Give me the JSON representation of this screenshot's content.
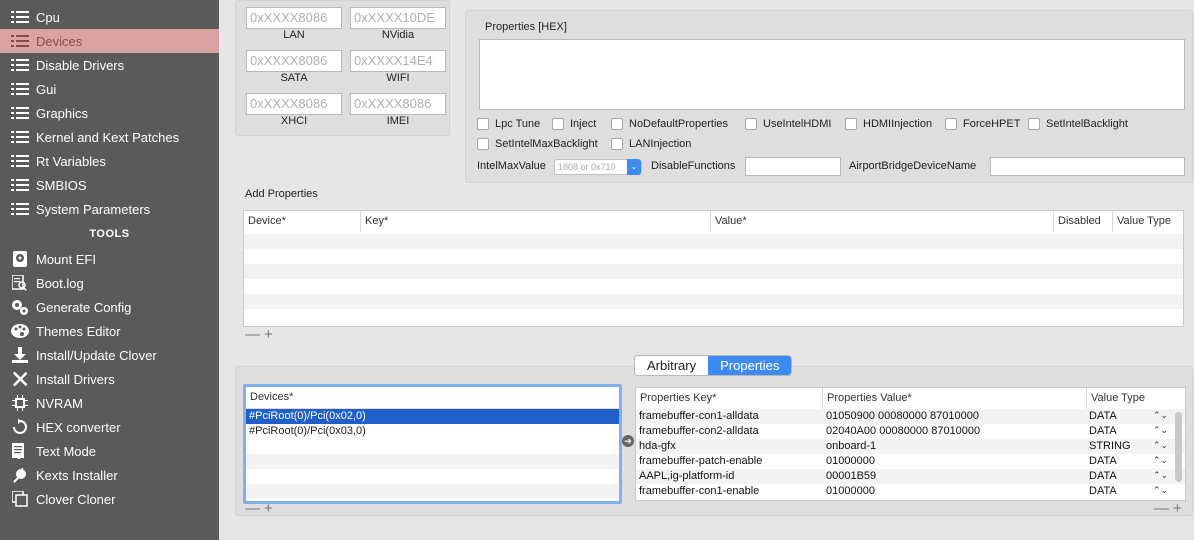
{
  "sidebar": {
    "items": [
      {
        "label": "Cpu",
        "icon": "list-icon",
        "active": false
      },
      {
        "label": "Devices",
        "icon": "list-icon",
        "active": true
      },
      {
        "label": "Disable Drivers",
        "icon": "list-icon",
        "active": false
      },
      {
        "label": "Gui",
        "icon": "list-icon",
        "active": false
      },
      {
        "label": "Graphics",
        "icon": "list-icon",
        "active": false
      },
      {
        "label": "Kernel and Kext Patches",
        "icon": "list-icon",
        "active": false
      },
      {
        "label": "Rt Variables",
        "icon": "list-icon",
        "active": false
      },
      {
        "label": "SMBIOS",
        "icon": "list-icon",
        "active": false
      },
      {
        "label": "System Parameters",
        "icon": "list-icon",
        "active": false
      }
    ],
    "tools_header": "TOOLS",
    "tools": [
      {
        "label": "Mount EFI",
        "icon": "disk-icon"
      },
      {
        "label": "Boot.log",
        "icon": "log-search-icon"
      },
      {
        "label": "Generate Config",
        "icon": "gears-icon"
      },
      {
        "label": "Themes Editor",
        "icon": "palette-icon"
      },
      {
        "label": "Install/Update Clover",
        "icon": "download-icon"
      },
      {
        "label": "Install Drivers",
        "icon": "tools-icon"
      },
      {
        "label": "NVRAM",
        "icon": "chip-icon"
      },
      {
        "label": "HEX converter",
        "icon": "refresh-icon"
      },
      {
        "label": "Text Mode",
        "icon": "text-icon"
      },
      {
        "label": "Kexts Installer",
        "icon": "plug-icon"
      },
      {
        "label": "Clover Cloner",
        "icon": "clone-icon"
      }
    ]
  },
  "fake_id": {
    "lan": {
      "placeholder": "0xXXXX8086",
      "label": "LAN"
    },
    "nvidia": {
      "placeholder": "0xXXXX10DE",
      "label": "NVidia"
    },
    "sata": {
      "placeholder": "0xXXXX8086",
      "label": "SATA"
    },
    "wifi": {
      "placeholder": "0xXXXX14E4",
      "label": "WIFI"
    },
    "xhci": {
      "placeholder": "0xXXXX8086",
      "label": "XHCI"
    },
    "imei": {
      "placeholder": "0xXXXX8086",
      "label": "IMEI"
    }
  },
  "properties_hex": {
    "title": "Properties [HEX]"
  },
  "checkboxes": {
    "lpc_tune": "Lpc Tune",
    "inject": "Inject",
    "no_default_properties": "NoDefaultProperties",
    "use_intel_hdmi": "UseIntelHDMI",
    "hdmi_injection": "HDMIInjection",
    "force_hpet": "ForceHPET",
    "set_intel_backlight": "SetIntelBacklight",
    "set_intel_max_backlight": "SetIntelMaxBacklight",
    "lan_injection": "LANInjection"
  },
  "fields": {
    "intel_max_value_label": "IntelMaxValue",
    "intel_max_value_placeholder": "1808 or 0x710",
    "disable_functions_label": "DisableFunctions",
    "airport_bridge_label": "AirportBridgeDeviceName"
  },
  "add_properties": {
    "title": "Add Properties",
    "columns": [
      "Device*",
      "Key*",
      "Value*",
      "Disabled",
      "Value Type"
    ]
  },
  "segmented": {
    "arbitrary": "Arbitrary",
    "properties": "Properties",
    "selected": "Properties"
  },
  "devices_list": {
    "header": "Devices*",
    "rows": [
      "#PciRoot(0)/Pci(0x02,0)",
      "#PciRoot(0)/Pci(0x03,0)"
    ],
    "selected_index": 0
  },
  "properties_table": {
    "columns": [
      "Properties Key*",
      "Properties Value*",
      "Value Type"
    ],
    "rows": [
      {
        "key": "framebuffer-con1-alldata",
        "value": "01050900 00080000 87010000",
        "type": "DATA"
      },
      {
        "key": "framebuffer-con2-alldata",
        "value": "02040A00 00080000 87010000",
        "type": "DATA"
      },
      {
        "key": "hda-gfx",
        "value": "onboard-1",
        "type": "STRING"
      },
      {
        "key": "framebuffer-patch-enable",
        "value": "01000000",
        "type": "DATA"
      },
      {
        "key": "AAPL,ig-platform-id",
        "value": "00001B59",
        "type": "DATA"
      },
      {
        "key": "framebuffer-con1-enable",
        "value": "01000000",
        "type": "DATA"
      }
    ]
  },
  "controls": {
    "minus": "—",
    "plus": "+"
  }
}
